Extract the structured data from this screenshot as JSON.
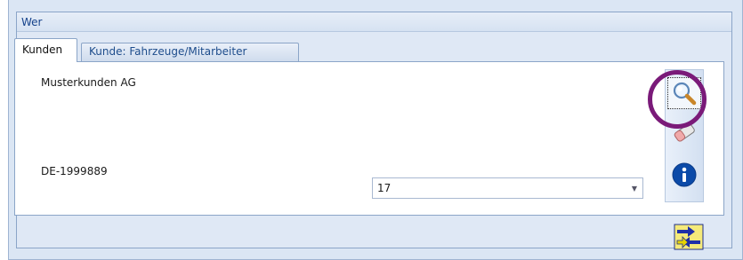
{
  "group": {
    "title": "Wer"
  },
  "tabs": [
    {
      "label": "Kunden",
      "active": true
    },
    {
      "label": "Kunde: Fahrzeuge/Mitarbeiter",
      "active": false
    }
  ],
  "customer": {
    "name": "Musterkunden AG",
    "id": "DE-1999889"
  },
  "combo": {
    "value": "17"
  },
  "toolbar": {
    "buttons": [
      {
        "icon": "magnifier-icon"
      },
      {
        "icon": "eraser-icon"
      },
      {
        "icon": "info-icon"
      }
    ]
  },
  "footer": {
    "button_icon": "transfer-arrows-icon"
  },
  "colors": {
    "highlight": "#7a1a79",
    "accent": "#15428b"
  }
}
